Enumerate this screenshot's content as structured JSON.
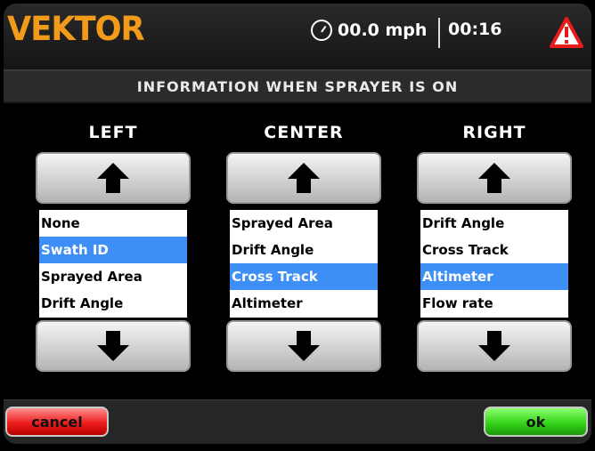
{
  "header": {
    "brand": "VEKTOR",
    "speed": "00.0 mph",
    "time": "00:16",
    "icons": {
      "gauge": "speedometer-icon",
      "alert": "warning-icon"
    }
  },
  "title": "INFORMATION WHEN SPRAYER IS ON",
  "columns": [
    {
      "label": "LEFT",
      "items": [
        "None",
        "Swath ID",
        "Sprayed Area",
        "Drift Angle"
      ],
      "selected": "Swath ID"
    },
    {
      "label": "CENTER",
      "items": [
        "Sprayed Area",
        "Drift Angle",
        "Cross Track",
        "Altimeter"
      ],
      "selected": "Cross Track"
    },
    {
      "label": "RIGHT",
      "items": [
        "Drift Angle",
        "Cross Track",
        "Altimeter",
        "Flow rate"
      ],
      "selected": "Altimeter"
    }
  ],
  "footer": {
    "cancel_label": "cancel",
    "ok_label": "ok"
  },
  "colors": {
    "accent": "#3d8ef5",
    "brand": "#f29a1a",
    "cancel": "#ee1d1d",
    "ok": "#35d41a",
    "alert": "#e61b1b"
  }
}
